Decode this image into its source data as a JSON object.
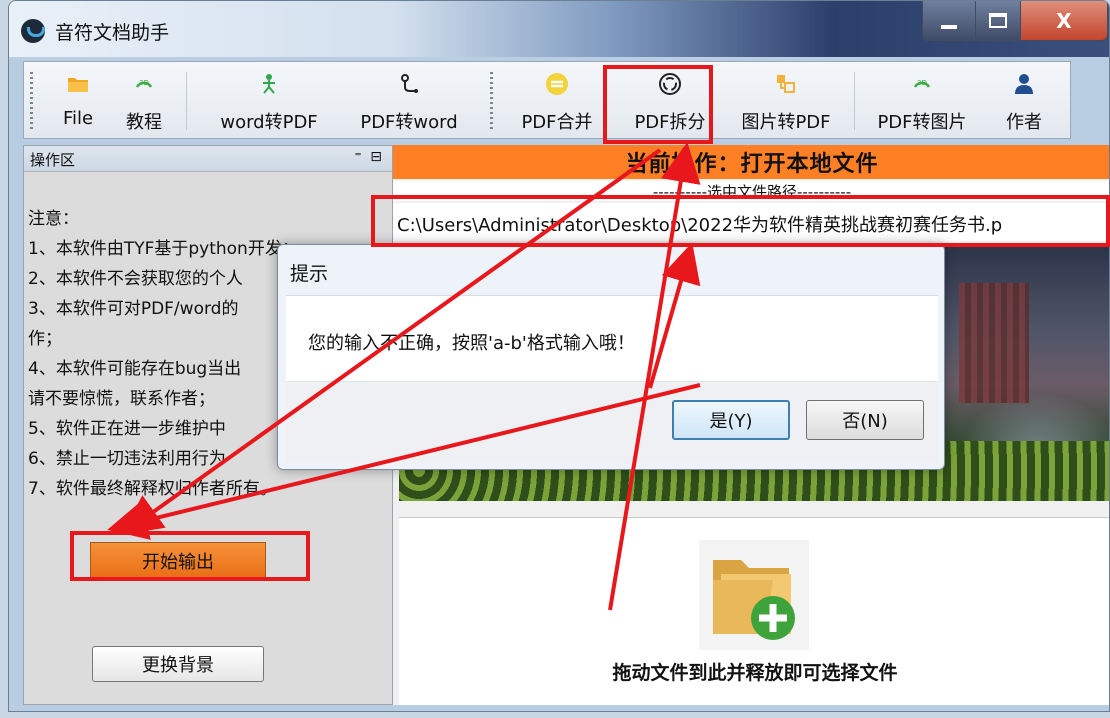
{
  "window": {
    "title": "音符文档助手",
    "min_symbol": "",
    "close_symbol": "X"
  },
  "toolbar": {
    "items": [
      {
        "label": "File",
        "icon": "folder-icon"
      },
      {
        "label": "教程",
        "icon": "help-icon"
      },
      {
        "label": "word转PDF",
        "icon": "convert-icon"
      },
      {
        "label": "PDF转word",
        "icon": "convert-icon"
      },
      {
        "label": "PDF合并",
        "icon": "merge-icon"
      },
      {
        "label": "PDF拆分",
        "icon": "split-icon"
      },
      {
        "label": "图片转PDF",
        "icon": "image-icon"
      },
      {
        "label": "PDF转图片",
        "icon": "image-icon"
      },
      {
        "label": "作者",
        "icon": "user-icon"
      }
    ]
  },
  "left_panel": {
    "header": "操作区",
    "notes": [
      "注意：",
      "1、本软件由TYF基于python开发；",
      "2、本软件不会获取您的个人",
      "3、本软件可对PDF/word的",
      "作；",
      "4、本软件可能存在bug当出",
      "请不要惊慌，联系作者；",
      "5、软件正在进一步维护中",
      "6、禁止一切违法利用行为",
      "7、软件最终解释权归作者所有。"
    ],
    "start_button": "开始输出",
    "change_bg_button": "更换背景"
  },
  "right_panel": {
    "operation_banner": "当前操作：打开本地文件",
    "path_header": "----------选中文件路径----------",
    "path_value": "C:\\Users\\Administrator\\Desktop\\2022华为软件精英挑战赛初赛任务书.p",
    "drop_text": "拖动文件到此并释放即可选择文件"
  },
  "dialog": {
    "title": "提示",
    "message": "您的输入不正确，按照'a-b'格式输入哦！",
    "yes_button": "是(Y)",
    "no_button": "否(N)"
  },
  "colors": {
    "accent_orange": "#ff7f24",
    "annotation_red": "#e8171c"
  }
}
